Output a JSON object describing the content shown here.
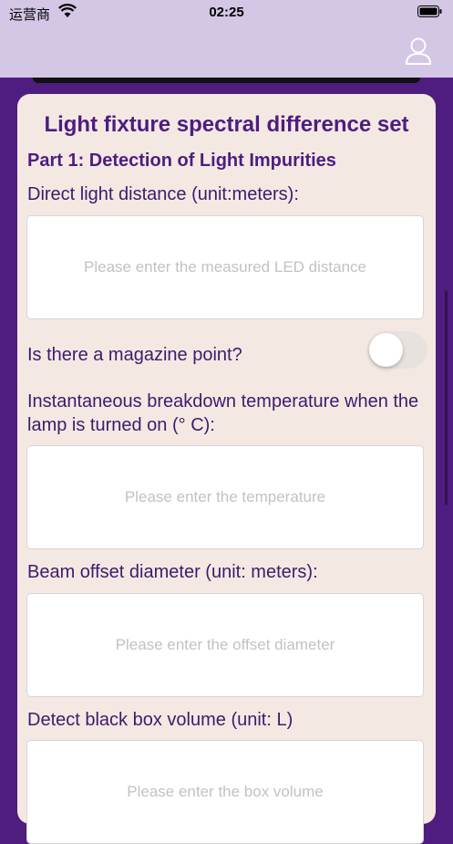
{
  "status_bar": {
    "carrier": "运营商",
    "time": "02:25"
  },
  "header": {
    "user_icon": "person-outline-icon"
  },
  "form": {
    "title": "Light fixture spectral difference set",
    "section": "Part 1: Detection of Light Impurities",
    "fields": [
      {
        "label": "Direct light distance (unit:meters):",
        "placeholder": "Please enter the measured LED distance",
        "value": ""
      },
      {
        "label": "Is there a magazine point?",
        "toggle_on": false
      },
      {
        "label": "Instantaneous breakdown temperature when the lamp is turned on (° C):",
        "placeholder": "Please enter the temperature",
        "value": ""
      },
      {
        "label": "Beam offset diameter (unit: meters):",
        "placeholder": "Please enter the offset diameter",
        "value": ""
      },
      {
        "label": "Detect black box volume (unit: L)",
        "placeholder": "Please enter the box volume",
        "value": ""
      }
    ]
  },
  "colors": {
    "background": "#4f1d80",
    "header": "#d3c7e5",
    "card": "#f3e9e2",
    "accent": "#4e1c82"
  }
}
